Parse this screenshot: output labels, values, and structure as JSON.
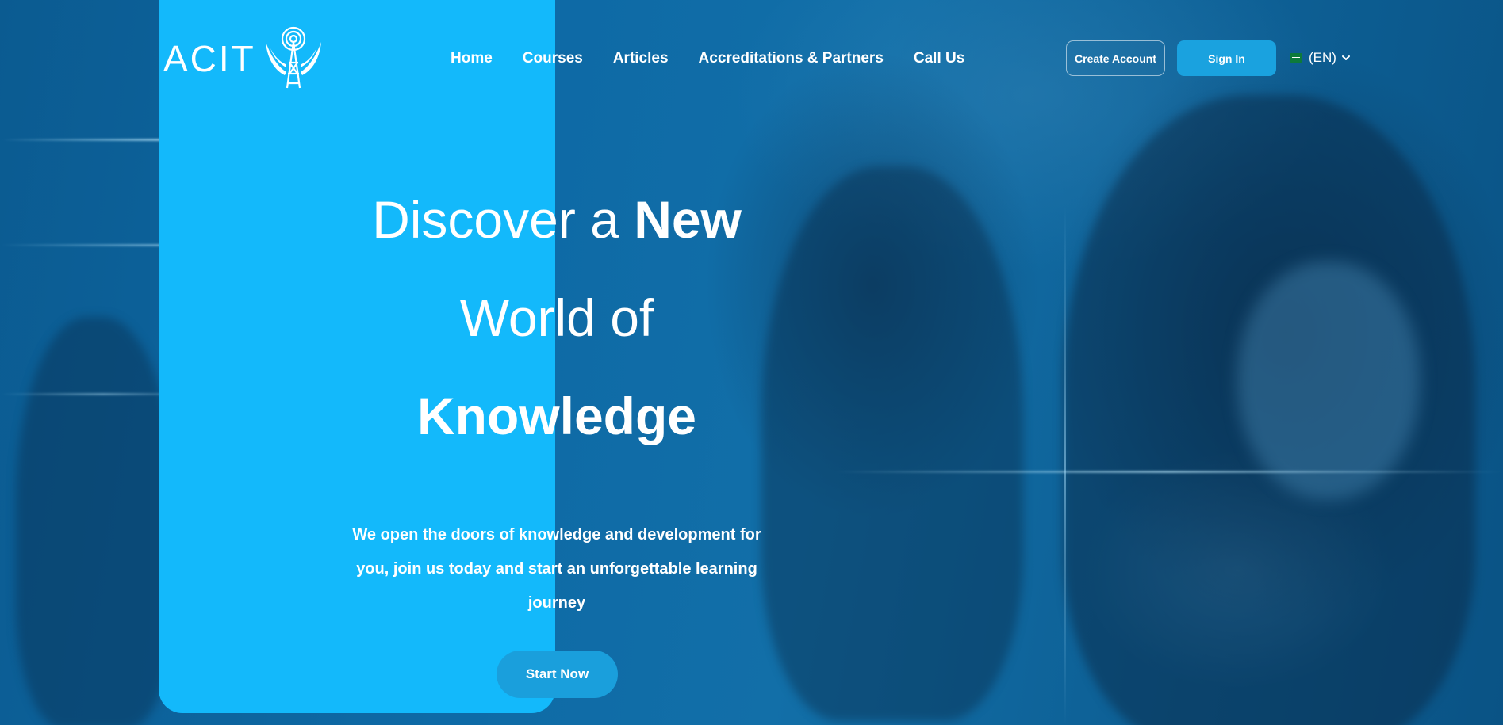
{
  "brand": {
    "logo_text": "ACIT"
  },
  "nav": {
    "items": [
      {
        "label": "Home"
      },
      {
        "label": "Courses"
      },
      {
        "label": "Articles"
      },
      {
        "label": "Accreditations & Partners"
      },
      {
        "label": "Call Us"
      }
    ]
  },
  "header_actions": {
    "create_account_label": "Create Account",
    "sign_in_label": "Sign In",
    "language_label": "(EN)",
    "language_flag_icon": "flag-icon"
  },
  "hero": {
    "line1_light": "Discover a ",
    "line1_bold": "New",
    "line2": "World of",
    "line3": "Knowledge",
    "subtitle": "We open the doors of knowledge and development for you, join us today and start an unforgettable learning journey",
    "cta_label": "Start Now"
  },
  "colors": {
    "panel": "#13b9fb",
    "button": "#1aa2df",
    "background": "#0e6aa6",
    "text": "#ffffff"
  }
}
